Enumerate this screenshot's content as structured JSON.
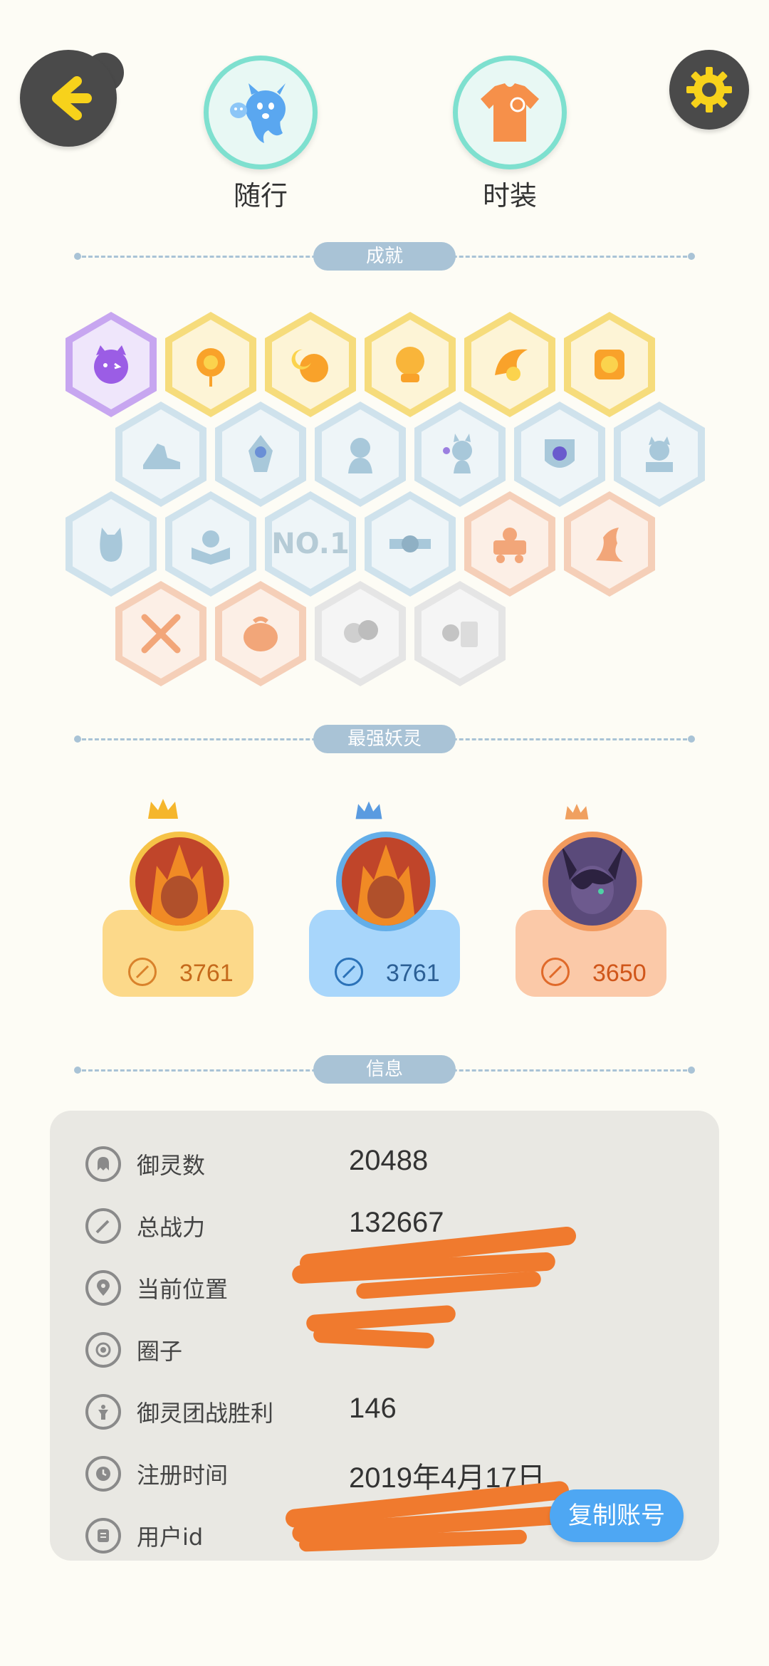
{
  "header": {
    "companion_label": "随行",
    "fashion_label": "时装"
  },
  "sections": {
    "achievements": "成就",
    "strongest": "最强妖灵",
    "info": "信息"
  },
  "achievements": {
    "badge_no1_text": "NO.1"
  },
  "champions": [
    {
      "power": "3761",
      "tier": "gold"
    },
    {
      "power": "3761",
      "tier": "blue"
    },
    {
      "power": "3650",
      "tier": "bronze"
    }
  ],
  "info": {
    "rows": [
      {
        "label": "御灵数",
        "value": "20488",
        "icon": "ghost-icon"
      },
      {
        "label": "总战力",
        "value": "132667",
        "icon": "sword-icon"
      },
      {
        "label": "当前位置",
        "value": "",
        "icon": "location-pin-icon"
      },
      {
        "label": "圈子",
        "value": "",
        "icon": "circle-target-icon"
      },
      {
        "label": "御灵团战胜利",
        "value": "146",
        "icon": "trophy-icon"
      },
      {
        "label": "注册时间",
        "value": "2019年4月17日",
        "icon": "clock-icon"
      },
      {
        "label": "用户id",
        "value": "",
        "icon": "id-card-icon"
      }
    ],
    "copy_button": "复制账号"
  },
  "colors": {
    "accent_blue": "#4ea7f3",
    "redaction": "#f07a2e",
    "section_pill": "#a9c3d6"
  }
}
